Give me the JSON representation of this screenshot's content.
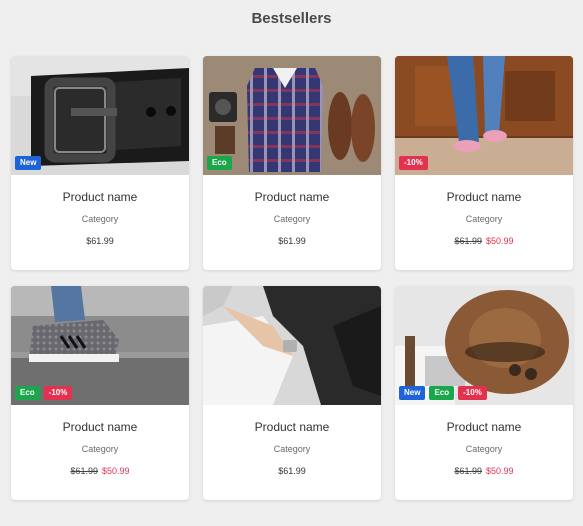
{
  "page": {
    "title": "Bestsellers"
  },
  "colors": {
    "new": "#1e63d8",
    "eco": "#1aa64a",
    "sale": "#e3324f"
  },
  "products": [
    {
      "name": "Product name",
      "category": "Category",
      "price": "$61.99",
      "sale_price": "",
      "badges": [
        "New"
      ],
      "image": "belt"
    },
    {
      "name": "Product name",
      "category": "Category",
      "price": "$61.99",
      "sale_price": "",
      "badges": [
        "Eco"
      ],
      "image": "shirt-and-shoes"
    },
    {
      "name": "Product name",
      "category": "Category",
      "price": "$61.99",
      "sale_price": "$50.99",
      "badges": [
        "-10%"
      ],
      "image": "jeans-and-sneakers"
    },
    {
      "name": "Product name",
      "category": "Category",
      "price": "$61.99",
      "sale_price": "$50.99",
      "badges": [
        "Eco",
        "-10%"
      ],
      "image": "running-shoes"
    },
    {
      "name": "Product name",
      "category": "Category",
      "price": "$61.99",
      "sale_price": "",
      "badges": [],
      "image": "leather-jacket"
    },
    {
      "name": "Product name",
      "category": "Category",
      "price": "$61.99",
      "sale_price": "$50.99",
      "badges": [
        "New",
        "Eco",
        "-10%"
      ],
      "image": "hat"
    }
  ]
}
